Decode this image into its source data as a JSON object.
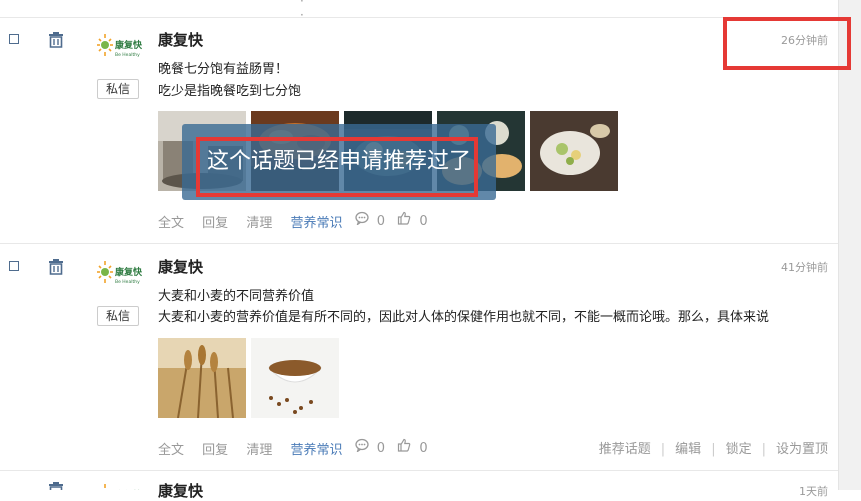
{
  "posts": [
    {
      "author": "康复快",
      "time": "26分钟前",
      "private_message": "私信",
      "lines": [
        "晚餐七分饱有益肠胃！",
        "吃少是指晚餐吃到七分饱"
      ],
      "images": [
        "restaurant-photo",
        "roast-food-photo",
        "dining-table-photo",
        "bread-dishes-photo",
        "salad-plate-photo"
      ],
      "actions": {
        "full_text": "全文",
        "reply": "回复",
        "clean": "清理",
        "tag": "营养常识",
        "comments": "0",
        "likes": "0"
      }
    },
    {
      "author": "康复快",
      "time": "41分钟前",
      "private_message": "私信",
      "lines": [
        "大麦和小麦的不同营养价值",
        "大麦和小麦的营养价值是有所不同的，因此对人体的保健作用也就不同，不能一概而论哦。那么，具体来说"
      ],
      "images": [
        "wheat-field-photo",
        "buckwheat-bowl-photo"
      ],
      "actions": {
        "full_text": "全文",
        "reply": "回复",
        "clean": "清理",
        "tag": "营养常识",
        "comments": "0",
        "likes": "0"
      },
      "admin_actions": {
        "recommend": "推荐话题",
        "edit": "编辑",
        "lock": "锁定",
        "pin": "设为置顶"
      }
    },
    {
      "author": "康复快",
      "time": "1天前"
    }
  ],
  "toast": {
    "message": "这个话题已经申请推荐过了"
  },
  "brand": {
    "logo_text": "康复快",
    "logo_sub": "Be Healthy"
  },
  "colors": {
    "accent": "#4a7bb7",
    "highlight": "#e53935",
    "toast_bg": "#3a6a94"
  }
}
